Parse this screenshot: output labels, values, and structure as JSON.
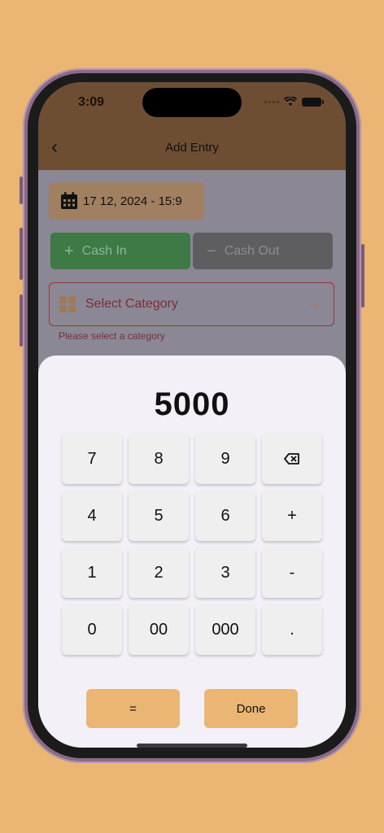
{
  "status_bar": {
    "time": "3:09"
  },
  "header": {
    "title": "Add Entry"
  },
  "form": {
    "date_text": "17 12, 2024 - 15:9",
    "cash_in_label": "Cash In",
    "cash_out_label": "Cash Out",
    "category_placeholder": "Select Category",
    "category_error": "Please select a category"
  },
  "calculator": {
    "display": "5000",
    "keys": [
      "7",
      "8",
      "9",
      "⌫",
      "4",
      "5",
      "6",
      "+",
      "1",
      "2",
      "3",
      "-",
      "0",
      "00",
      "000",
      "."
    ],
    "equals_label": "=",
    "done_label": "Done"
  },
  "colors": {
    "background": "#EBB574",
    "cash_in": "#3d7a45",
    "accent": "#EBB574",
    "error": "#7a2f35"
  }
}
